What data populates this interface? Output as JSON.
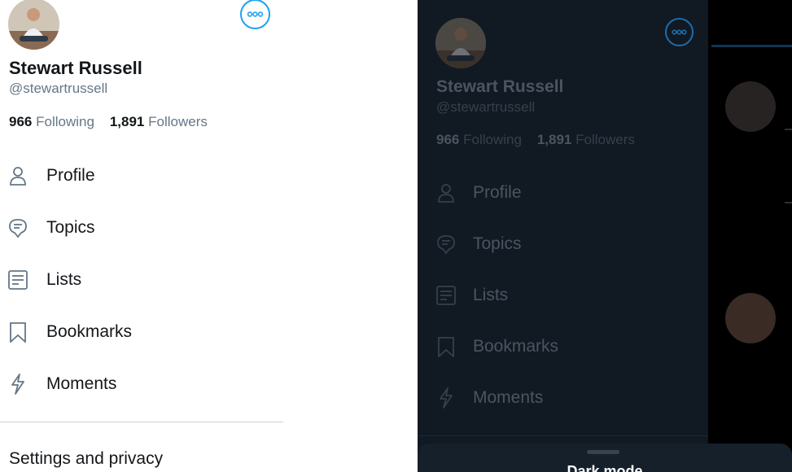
{
  "light": {
    "name": "Stewart Russell",
    "handle": "@stewartrussell",
    "following_count": "966",
    "following_label": "Following",
    "followers_count": "1,891",
    "followers_label": "Followers",
    "menu": [
      {
        "label": "Profile",
        "icon": "person-icon"
      },
      {
        "label": "Topics",
        "icon": "topics-icon"
      },
      {
        "label": "Lists",
        "icon": "lists-icon"
      },
      {
        "label": "Bookmarks",
        "icon": "bookmark-icon"
      },
      {
        "label": "Moments",
        "icon": "lightning-icon"
      }
    ],
    "settings": "Settings and privacy"
  },
  "dark": {
    "name": "Stewart Russell",
    "handle": "@stewartrussell",
    "following_count": "966",
    "following_label": "Following",
    "followers_count": "1,891",
    "followers_label": "Followers",
    "menu": [
      {
        "label": "Profile",
        "icon": "person-icon"
      },
      {
        "label": "Topics",
        "icon": "topics-icon"
      },
      {
        "label": "Lists",
        "icon": "lists-icon"
      },
      {
        "label": "Bookmarks",
        "icon": "bookmark-icon"
      },
      {
        "label": "Moments",
        "icon": "lightning-icon"
      }
    ],
    "sheet_title": "Dark mode"
  },
  "colors": {
    "accent": "#1da1f2",
    "light_text": "#14171a",
    "light_secondary": "#657786",
    "dark_bg": "#111923"
  }
}
